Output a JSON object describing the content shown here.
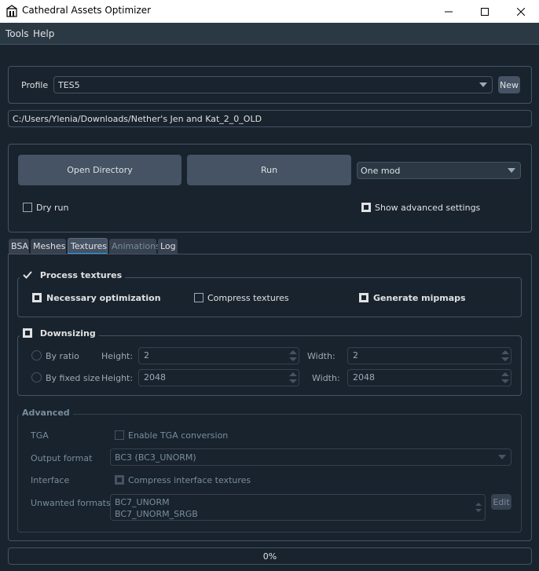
{
  "window": {
    "title": "Cathedral Assets Optimizer",
    "minimize_icon": "minimize-icon",
    "maximize_icon": "maximize-icon",
    "close_icon": "close-icon"
  },
  "menu": [
    "Tools",
    "Help"
  ],
  "profile": {
    "label": "Profile",
    "value": "TES5",
    "new_button": "New"
  },
  "path": {
    "value": "C:/Users/Ylenia/Downloads/Nether's Jen and Kat_2_0_OLD"
  },
  "actions": {
    "open_directory": "Open Directory",
    "run": "Run",
    "mode": "One mod",
    "dry_run": "Dry run",
    "dry_run_checked": false,
    "show_advanced": "Show advanced settings",
    "show_advanced_checked": true
  },
  "tabs": [
    {
      "label": "BSA",
      "active": false,
      "enabled": true
    },
    {
      "label": "Meshes",
      "active": false,
      "enabled": true
    },
    {
      "label": "Textures",
      "active": true,
      "enabled": true
    },
    {
      "label": "Animations",
      "active": false,
      "enabled": false
    },
    {
      "label": "Log",
      "active": false,
      "enabled": true
    }
  ],
  "process_textures": {
    "title": "Process textures",
    "checked": true,
    "necessary_optimization": "Necessary optimization",
    "compress_textures": "Compress textures",
    "generate_mipmaps": "Generate mipmaps"
  },
  "downsizing": {
    "title": "Downsizing",
    "checked": false,
    "by_ratio": "By ratio",
    "by_fixed_size": "By fixed size",
    "height_label": "Height:",
    "width_label": "Width:",
    "ratio_height": "2",
    "ratio_width": "2",
    "fixed_height": "2048",
    "fixed_width": "2048"
  },
  "advanced": {
    "title": "Advanced",
    "tga_label": "TGA",
    "tga_option": "Enable TGA conversion",
    "output_format_label": "Output format",
    "output_format_value": "BC3 (BC3_UNORM)",
    "interface_label": "Interface",
    "interface_option": "Compress interface textures",
    "unwanted_label": "Unwanted formats",
    "unwanted_list": [
      "BC7_UNORM",
      "BC7_UNORM_SRGB"
    ],
    "edit_button": "Edit"
  },
  "progress": {
    "text": "0%",
    "value": 0
  }
}
